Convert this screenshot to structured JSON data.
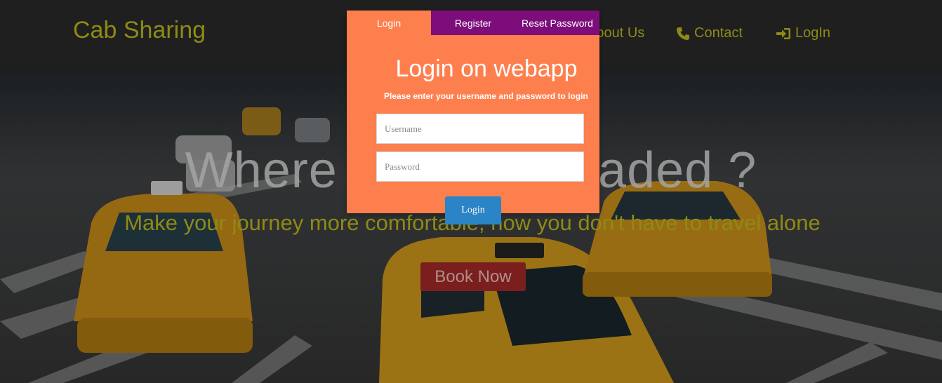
{
  "navbar": {
    "brand": "Cab Sharing",
    "links": [
      {
        "label": "About Us",
        "icon": "info-icon"
      },
      {
        "label": "Contact",
        "icon": "phone-icon"
      },
      {
        "label": "LogIn",
        "icon": "sign-in-icon"
      }
    ]
  },
  "hero": {
    "title": "Where are you headed ?",
    "tagline": "Make your journey more comfortable, now you don't have to travel alone",
    "book_button": "Book Now"
  },
  "modal": {
    "tabs": [
      "Login",
      "Register",
      "Reset Password"
    ],
    "active_tab": "Login",
    "title": "Login on webapp",
    "subtitle": "Please enter your username and password to login",
    "username_placeholder": "Username",
    "password_placeholder": "Password",
    "login_button": "Login"
  },
  "colors": {
    "brand": "#8f8a17",
    "modal_bg": "#fe7f4e",
    "tab_inactive": "#7e0d7c",
    "login_button": "#2a84c5",
    "book_button": "#7a1f1e"
  }
}
